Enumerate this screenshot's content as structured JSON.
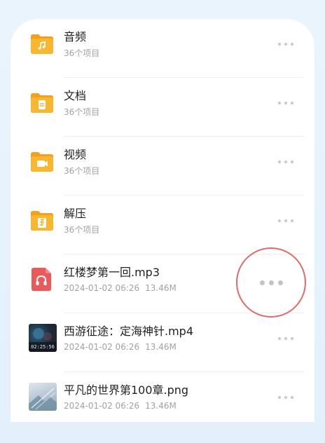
{
  "files": [
    {
      "type": "folder",
      "icon": "music-folder-icon",
      "name": "音频",
      "meta": "36个项目"
    },
    {
      "type": "folder",
      "icon": "document-folder-icon",
      "name": "文档",
      "meta": "36个项目"
    },
    {
      "type": "folder",
      "icon": "video-folder-icon",
      "name": "视频",
      "meta": "36个项目"
    },
    {
      "type": "folder",
      "icon": "archive-folder-icon",
      "name": "解压",
      "meta": "36个项目"
    },
    {
      "type": "audio",
      "icon": "headphones-file-icon",
      "name": "红楼梦第一回.mp3",
      "date": "2024-01-02 06:26",
      "size": "13.46M"
    },
    {
      "type": "video",
      "icon": "video-thumbnail",
      "name": "西游征途：定海神针.mp4",
      "date": "2024-01-02 06:26",
      "size": "13.46M",
      "duration": "02:25:56"
    },
    {
      "type": "image",
      "icon": "image-thumbnail",
      "name": "平凡的世界第100章.png",
      "date": "2024-01-02 06:26",
      "size": "13.46M"
    }
  ],
  "colors": {
    "background": "#eaf4fd",
    "folder": "#f7b731",
    "folder_tab": "#f59f1a",
    "audio_file": "#eb5a5a",
    "highlight_ring": "#e36a6a"
  },
  "highlight": {
    "target_row": 4,
    "icon": "more-options-icon"
  }
}
